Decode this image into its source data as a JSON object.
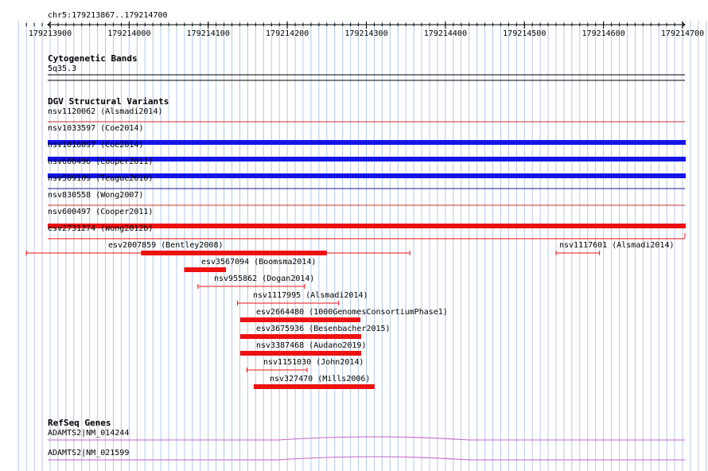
{
  "region": "chr5:179213867..179214700",
  "ruler_ticks": [
    "179213900",
    "179214000",
    "179214100",
    "179214200",
    "179214300",
    "179214400",
    "179214500",
    "179214600",
    "179214700"
  ],
  "cytoband": {
    "title": "Cytogenetic Bands",
    "band": "5q35.3"
  },
  "dgv": {
    "title": "DGV Structural Variants",
    "full_rows": [
      {
        "label": "nsv1120062 (Alsmadi2014)",
        "color": "#c83232"
      },
      {
        "label": "nsv1033597 (Coe2014)",
        "color": "#1414e6"
      },
      {
        "label": "nsv1016097 (Coe2014)",
        "color": "#1414e6"
      },
      {
        "label": "nsv600496 (Cooper2011)",
        "color": "#1414e6"
      },
      {
        "label": "nsv509109 (Teague2010)",
        "color": "#1a1a8c"
      },
      {
        "label": "nsv830558 (Wong2007)",
        "color": "#c83232"
      },
      {
        "label": "nsv600497 (Cooper2011)",
        "color": "#ee1111"
      },
      {
        "label": "esv2731274 (Wong2012b)",
        "color": "#ee1111"
      }
    ],
    "features": [
      {
        "label": "esv2007859 (Bentley2008)",
        "start": 179213870,
        "end": 179214355,
        "thick_start": 179214015,
        "thick_end": 179214250
      },
      {
        "label": "nsv1117601 (Alsmadi2014)",
        "start": 179214540,
        "end": 179214595
      },
      {
        "label": "esv3567094 (Boomsma2014)",
        "start": 179214070,
        "end": 179214122,
        "thick_start": 179214070,
        "thick_end": 179214122
      },
      {
        "label": "nsv955862 (Dogan2014)",
        "start": 179214087,
        "end": 179214222
      },
      {
        "label": "nsv1117995 (Alsmadi2014)",
        "start": 179214137,
        "end": 179214265
      },
      {
        "label": "esv2664480 (1000GenomesConsortiumPhase1)",
        "start": 179214141,
        "end": 179214292,
        "thick_start": 179214141,
        "thick_end": 179214292
      },
      {
        "label": "esv3675936 (Besenbacher2015)",
        "start": 179214141,
        "end": 179214293,
        "thick_start": 179214141,
        "thick_end": 179214293
      },
      {
        "label": "nsv3387468 (Audano2019)",
        "start": 179214141,
        "end": 179214293,
        "thick_start": 179214141,
        "thick_end": 179214293
      },
      {
        "label": "nsv1151030 (John2014)",
        "start": 179214149,
        "end": 179214225
      },
      {
        "label": "nsv327470 (Mills2006)",
        "start": 179214158,
        "end": 179214310,
        "thick_start": 179214158,
        "thick_end": 179214310
      }
    ]
  },
  "refseq": {
    "title": "RefSeq Genes",
    "genes": [
      {
        "label": "ADAMTS2|NM_014244"
      },
      {
        "label": "ADAMTS2|NM_021599"
      }
    ]
  },
  "colors": {
    "grid": "#b4c8e6",
    "feature_red": "#ee1111",
    "gene_line": "#c864c8"
  }
}
